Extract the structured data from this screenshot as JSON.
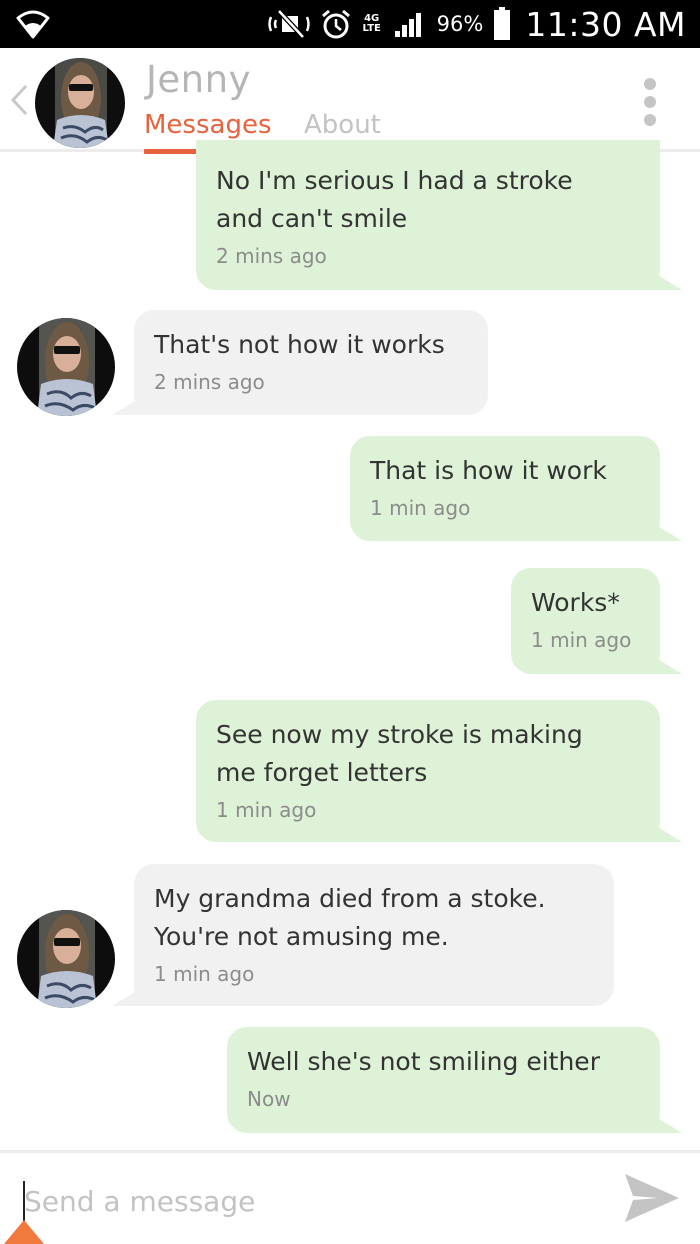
{
  "status_bar": {
    "network": "4G",
    "network_sub": "LTE",
    "battery": "96%",
    "time": "11:30 AM"
  },
  "header": {
    "name": "Jenny",
    "tabs": [
      "Messages",
      "About"
    ],
    "active_tab": "Messages"
  },
  "messages": [
    {
      "direction": "outgoing",
      "lines": [
        "No I'm serious I had a stroke",
        "and can't smile"
      ],
      "time": "2 mins ago"
    },
    {
      "direction": "incoming",
      "lines": [
        "That's not how it works"
      ],
      "time": "2 mins ago"
    },
    {
      "direction": "outgoing",
      "lines": [
        "That is how it work"
      ],
      "time": "1 min ago"
    },
    {
      "direction": "outgoing",
      "lines": [
        "Works*"
      ],
      "time": "1 min ago"
    },
    {
      "direction": "outgoing",
      "lines": [
        "See now my stroke is making",
        "me forget letters"
      ],
      "time": "1 min ago"
    },
    {
      "direction": "incoming",
      "lines": [
        "My grandma died from a stoke.",
        "You're not amusing me."
      ],
      "time": "1 min ago"
    },
    {
      "direction": "outgoing",
      "lines": [
        "Well she's not smiling either"
      ],
      "time": "Now"
    }
  ],
  "composer": {
    "placeholder": "Send a message"
  },
  "colors": {
    "accent": "#e8623d",
    "outgoing_bubble": "#ddf2d6",
    "incoming_bubble": "#f1f1f1"
  },
  "icons": [
    "wifi-icon",
    "mute-icon",
    "alarm-icon",
    "signal-icon",
    "battery-icon",
    "back-chevron-icon",
    "overflow-menu-icon",
    "send-icon"
  ]
}
